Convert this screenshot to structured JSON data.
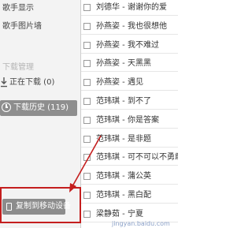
{
  "sidebar": {
    "items": [
      {
        "label": "歌手显示"
      },
      {
        "label": "歌手图片墙"
      }
    ],
    "download_section": {
      "header": "下载管理",
      "downloading": "正在下载 (0)",
      "history": "下载历史 (119)"
    },
    "copy_button": "复制到移动设备"
  },
  "songs": [
    {
      "title": "刘德华 - 谢谢你的爱"
    },
    {
      "title": "孙燕姿 - 我也很想他"
    },
    {
      "title": "孙燕姿 - 我不难过"
    },
    {
      "title": "孙燕姿 - 天黑黑"
    },
    {
      "title": "孙燕姿 - 遇见"
    },
    {
      "title": "范玮琪 - 到不了"
    },
    {
      "title": "范玮琪 - 你是答案"
    },
    {
      "title": "范玮琪 - 是非题"
    },
    {
      "title": "范玮琪 - 可不可以不勇敢"
    },
    {
      "title": "范玮琪 - 蒲公英"
    },
    {
      "title": "范玮琪 - 黑白配"
    },
    {
      "title": "梁静茹 - 宁夏"
    }
  ],
  "watermark": "jingyan.baidu.com",
  "colors": {
    "highlight_box": "#c41e1e",
    "button_bg": "#8e8e8e",
    "sidebar_bg": "#f3f3f3"
  }
}
